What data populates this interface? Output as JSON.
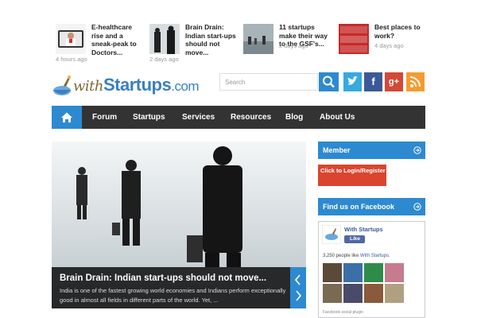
{
  "news": [
    {
      "title": "E-healthcare rise and a sneak-peak to Doctors...",
      "time": "4 hours ago"
    },
    {
      "title": "Brain Drain: Indian start-ups should not move...",
      "time": "2 days ago"
    },
    {
      "title": "11 startups make their way to the GSF's...",
      "time": "2 days ago"
    },
    {
      "title": "Best places to work?",
      "time": "4 days ago"
    }
  ],
  "logo": {
    "with": "with",
    "brand": "Startups",
    "tld": ".com"
  },
  "search": {
    "placeholder": "Search"
  },
  "social": {
    "twitter": "t",
    "facebook": "f",
    "gplus": "g+",
    "rss": "rss"
  },
  "nav": {
    "items": [
      "Forum",
      "Startups",
      "Services",
      "Resources",
      "Blog",
      "About Us"
    ]
  },
  "feature": {
    "title": "Brain Drain: Indian start-ups should not move...",
    "excerpt": "India is one of the fastest growing world economies and Indians perform exceptionally good in almost all fields in different parts of the world. Yet, ..."
  },
  "sidebar": {
    "member_title": "Member",
    "login_label": "Click to Login/Register",
    "facebook_title": "Find us on Facebook"
  },
  "fb": {
    "page_name": "With Startups",
    "like_label": "Like",
    "count_text": "3,250 people like ",
    "count_link": "With Startups.",
    "footer": "Facebook social plugin"
  },
  "colors": {
    "accent": "#2d8ad0",
    "nav_bg": "#333333",
    "login_red": "#d9452f"
  }
}
